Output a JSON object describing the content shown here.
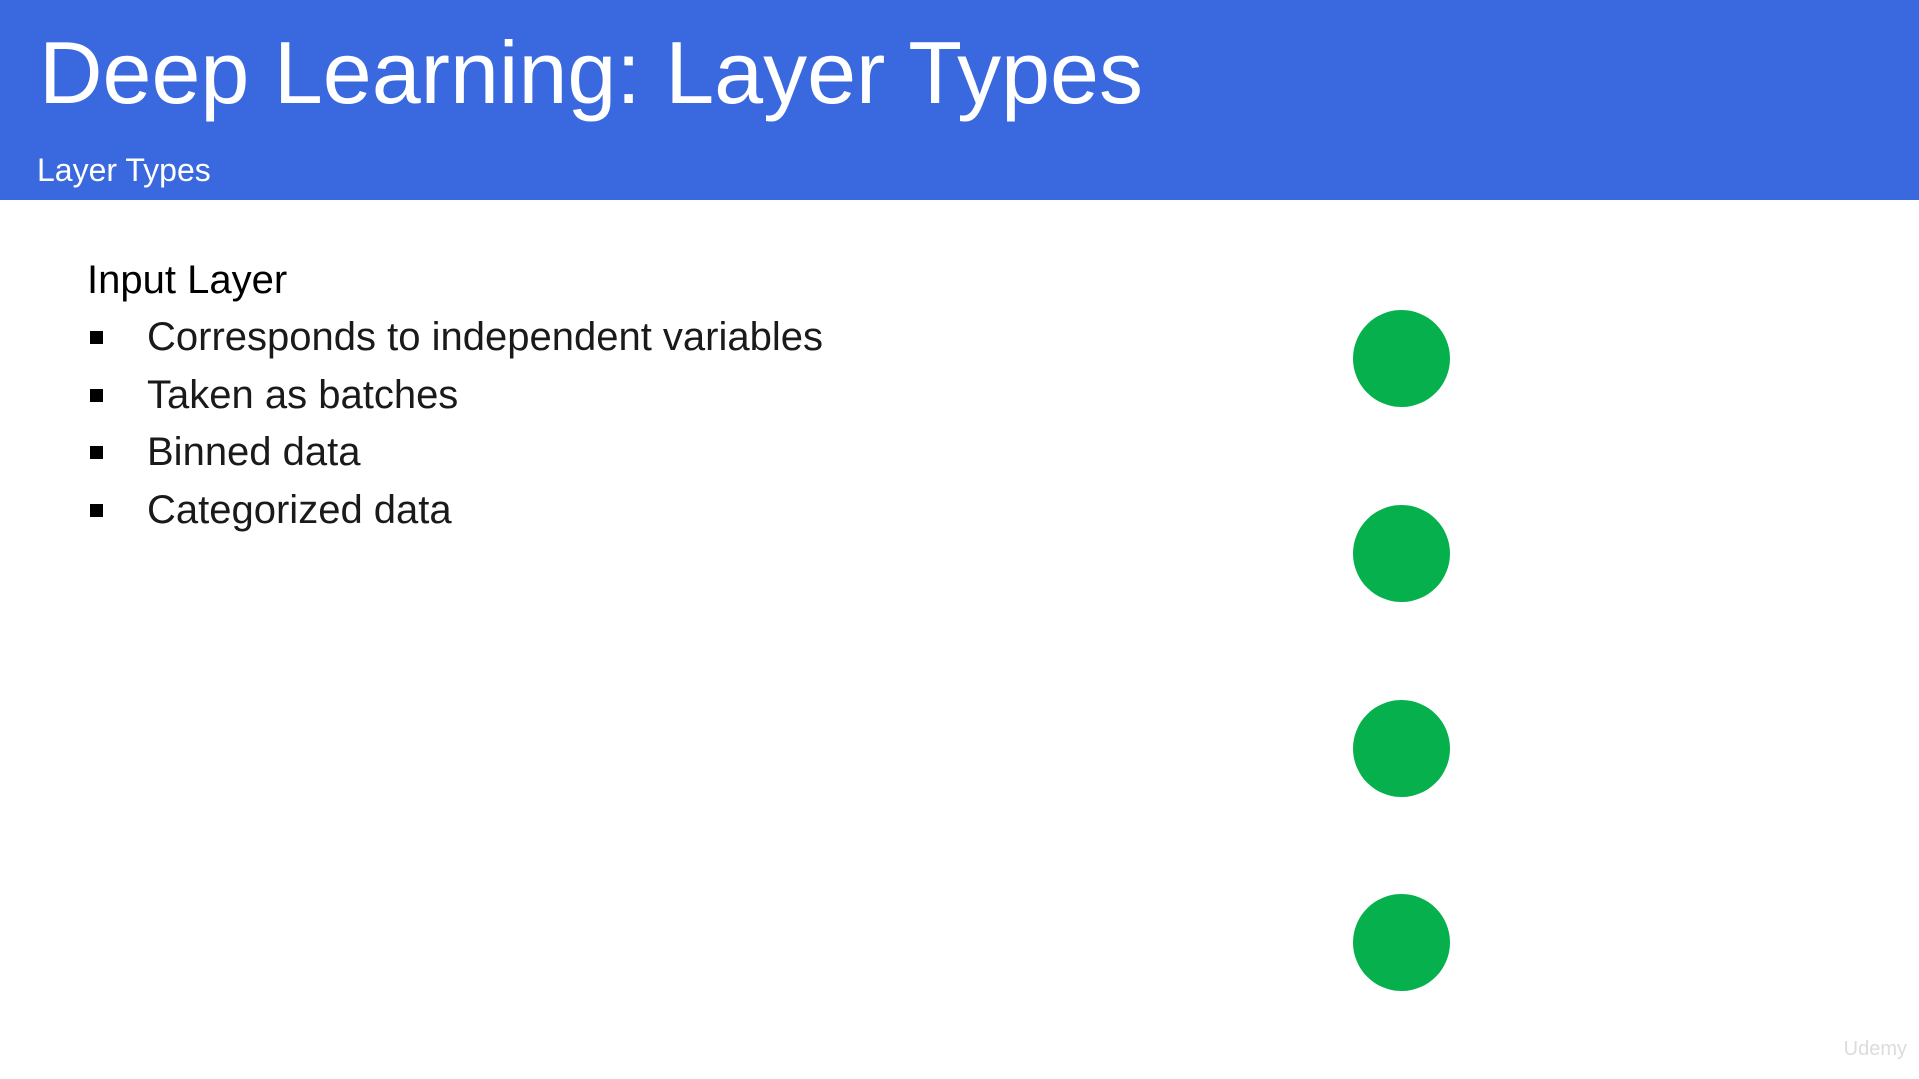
{
  "slide": {
    "title": "Deep Learning: Layer Types",
    "subtitle": "Layer Types"
  },
  "content": {
    "heading": "Input Layer",
    "bullets": [
      "Corresponds to independent variables",
      "Taken as batches",
      "Binned data",
      "Categorized data"
    ]
  },
  "diagram": {
    "node_count": 4,
    "node_color": "#06b04c",
    "node_icon": "circle-node-icon"
  },
  "colors": {
    "header_background": "#3a68de",
    "header_text": "#ffffff",
    "body_text": "#1a1a1a"
  },
  "watermark": "Udemy"
}
